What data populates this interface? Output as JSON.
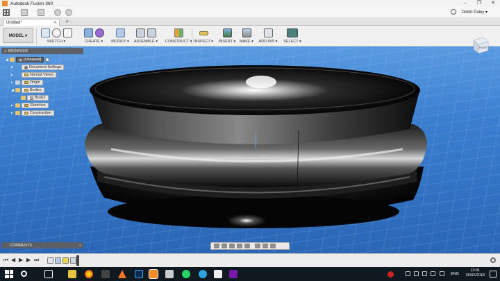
{
  "window": {
    "title": "Autodesk Fusion 360",
    "controls": [
      "–",
      "❐",
      "✕"
    ]
  },
  "quickbar": {
    "user": "Dmitri Paley ▾"
  },
  "tabs": [
    {
      "label": "Untitled*",
      "close": "✕"
    }
  ],
  "tab_add": "+",
  "toolbar": {
    "workspace": "MODEL ▾",
    "groups": [
      {
        "label": "SKETCH ▾"
      },
      {
        "label": "CREATE ▾"
      },
      {
        "label": "MODIFY ▾"
      },
      {
        "label": "ASSEMBLE ▾"
      },
      {
        "label": "CONSTRUCT ▾"
      },
      {
        "label": "INSPECT ▾"
      },
      {
        "label": "INSERT ▾"
      },
      {
        "label": "MAKE ▾"
      },
      {
        "label": "ADD-INS ▾"
      },
      {
        "label": "SELECT ▾"
      }
    ]
  },
  "browser": {
    "title": "BROWSER",
    "collapse": "◂",
    "items": [
      {
        "label": "(Unsaved)"
      },
      {
        "label": "Document Settings"
      },
      {
        "label": "Named Views"
      },
      {
        "label": "Origin"
      },
      {
        "label": "Bodies"
      },
      {
        "label": "Body2"
      },
      {
        "label": "Sketches"
      },
      {
        "label": "Construction"
      }
    ]
  },
  "viewcube": {
    "label": "RIGHT"
  },
  "comments": {
    "title": "COMMENTS",
    "plus": "+"
  },
  "timeline": {
    "buttons": [
      "⏮",
      "◀",
      "▶",
      "▶",
      "⏭"
    ]
  },
  "taskbar": {
    "lang": "ENG",
    "time": "13:01",
    "date": "26/02/2018"
  },
  "colors": {
    "viewport_top": "#5a9be0",
    "viewport_bottom": "#2a66b5",
    "panel_header": "#5c6066",
    "accent_orange": "#f08a24"
  }
}
